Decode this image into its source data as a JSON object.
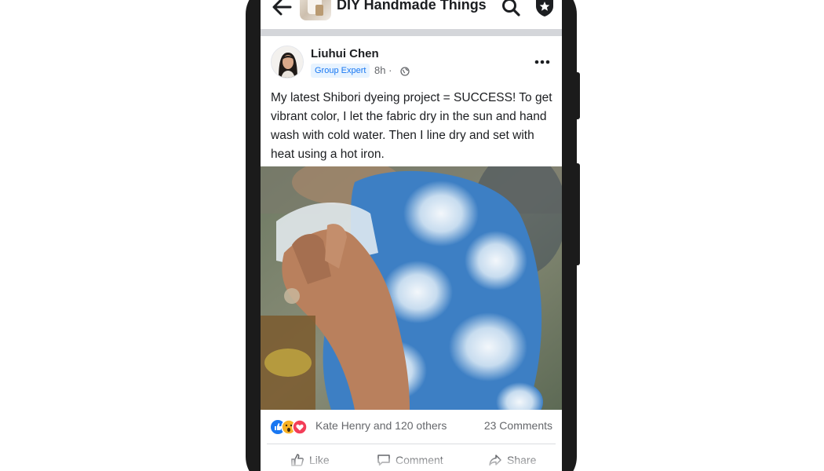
{
  "group": {
    "title": "DIY Handmade Things"
  },
  "post": {
    "author": "Liuhui Chen",
    "badge": "Group Expert",
    "time": "8h",
    "dot": "·",
    "text": "My latest Shibori dyeing project = SUCCESS!  To get vibrant color, I let the fabric dry in the sun and hand wash with cold water. Then I line dry and set with heat using a hot iron.",
    "reaction_summary": "Kate Henry and 120 others",
    "comment_count": "23 Comments"
  },
  "reactions": [
    "like-icon",
    "wow-icon",
    "love-icon"
  ],
  "actions": {
    "like": "Like",
    "comment": "Comment",
    "share": "Share"
  },
  "colors": {
    "accent": "#1877f2",
    "badge_bg": "#e7f3ff",
    "divider": "#d4d6da",
    "phone": "#1b1b1b",
    "fabric_blue": "#3d7fc4"
  }
}
